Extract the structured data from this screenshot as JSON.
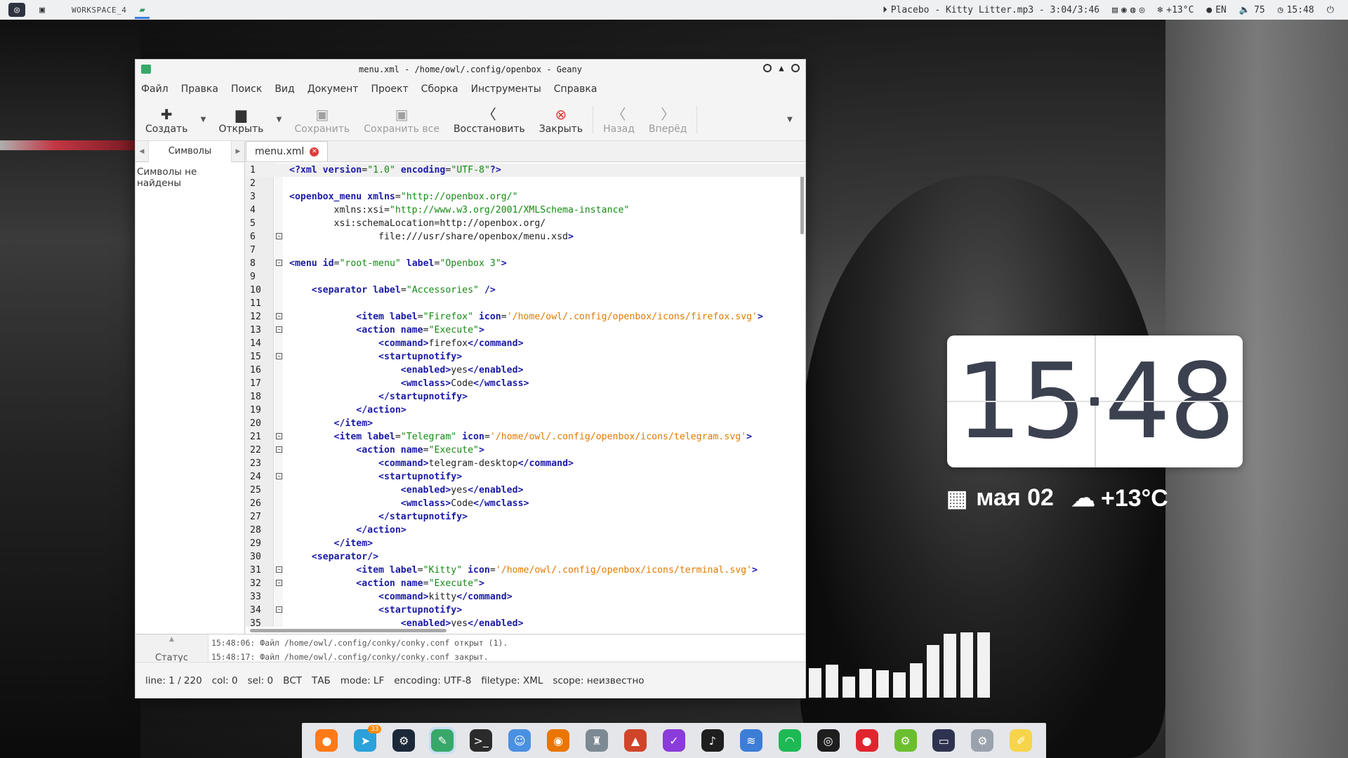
{
  "topbar": {
    "workspace": "WORKSPACE_4",
    "media": "Placebo - Kitty Litter.mp3 - 3:04/3:46",
    "temp": "+13°C",
    "lang": "EN",
    "volume": "75",
    "time": "15:48"
  },
  "window": {
    "title": "menu.xml - /home/owl/.config/openbox - Geany",
    "menu": [
      "Файл",
      "Правка",
      "Поиск",
      "Вид",
      "Документ",
      "Проект",
      "Сборка",
      "Инструменты",
      "Справка"
    ],
    "toolbar": {
      "create": "Создать",
      "open": "Открыть",
      "save": "Сохранить",
      "save_all": "Сохранить все",
      "revert": "Восстановить",
      "close": "Закрыть",
      "back": "Назад",
      "forward": "Вперёд"
    },
    "sidebar": {
      "tab": "Символы",
      "empty": "Символы не найдены"
    },
    "editor_tab": "menu.xml",
    "messages": {
      "label": "Статус",
      "lines": [
        "15:48:06: Файл /home/owl/.config/conky/conky.conf открыт (1).",
        "15:48:17: Файл /home/owl/.config/conky/conky.conf закрыт."
      ]
    },
    "status": {
      "line": "line: 1 / 220",
      "col": "col: 0",
      "sel": "sel: 0",
      "ins": "ВСТ",
      "tab": "ТАБ",
      "mode": "mode: LF",
      "encoding": "encoding: UTF-8",
      "filetype": "filetype: XML",
      "scope": "scope: неизвестно"
    }
  },
  "code_lines": [
    "<?xml version=\"1.0\" encoding=\"UTF-8\"?>",
    "",
    "<openbox_menu xmlns=\"http://openbox.org/\"",
    "        xmlns:xsi=\"http://www.w3.org/2001/XMLSchema-instance\"",
    "        xsi:schemaLocation=\"http://openbox.org/",
    "                file:///usr/share/openbox/menu.xsd\">",
    "",
    "<menu id=\"root-menu\" label=\"Openbox 3\">",
    "",
    "    <separator label=\"Accessories\" />",
    "",
    "            <item label=\"Firefox\" icon='/home/owl/.config/openbox/icons/firefox.svg'>",
    "            <action name=\"Execute\">",
    "                <command>firefox</command>",
    "                <startupnotify>",
    "                    <enabled>yes</enabled>",
    "                    <wmclass>Code</wmclass>",
    "                </startupnotify>",
    "            </action>",
    "        </item>",
    "        <item label=\"Telegram\" icon='/home/owl/.config/openbox/icons/telegram.svg'>",
    "            <action name=\"Execute\">",
    "                <command>telegram-desktop</command>",
    "                <startupnotify>",
    "                    <enabled>yes</enabled>",
    "                    <wmclass>Code</wmclass>",
    "                </startupnotify>",
    "            </action>",
    "        </item>",
    "    <separator/>",
    "            <item label=\"Kitty\" icon='/home/owl/.config/openbox/icons/terminal.svg'>",
    "            <action name=\"Execute\">",
    "                <command>kitty</command>",
    "                <startupnotify>",
    "                    <enabled>yes</enabled>"
  ],
  "fold_lines": [
    6,
    8,
    12,
    13,
    15,
    21,
    22,
    24,
    31,
    32,
    34
  ],
  "widgets": {
    "clock_hours": "15",
    "clock_minutes": "48",
    "date": "мая 02",
    "temp": "+13°C",
    "bar_levels": [
      0.45,
      0.5,
      0.32,
      0.44,
      0.42,
      0.38,
      0.52,
      0.8,
      0.97,
      0.99,
      0.99
    ]
  },
  "dock": {
    "items": [
      {
        "name": "firefox",
        "color": "#ff7a18",
        "glyph": "●"
      },
      {
        "name": "telegram",
        "color": "#2aa1da",
        "glyph": "➤",
        "badge": "33"
      },
      {
        "name": "steam",
        "color": "#1b2838",
        "glyph": "⚙"
      },
      {
        "name": "geany",
        "color": "#37a86a",
        "glyph": "✎",
        "active": true
      },
      {
        "name": "terminal",
        "color": "#2b2b2b",
        "glyph": ">_"
      },
      {
        "name": "finder",
        "color": "#4a90e2",
        "glyph": "☺"
      },
      {
        "name": "blender",
        "color": "#ea7600",
        "glyph": "◉"
      },
      {
        "name": "robot",
        "color": "#7d8a93",
        "glyph": "♜"
      },
      {
        "name": "rawtherapee",
        "color": "#d0452a",
        "glyph": "▲"
      },
      {
        "name": "editor",
        "color": "#8b3bd9",
        "glyph": "✓"
      },
      {
        "name": "music",
        "color": "#1e1e1e",
        "glyph": "♪"
      },
      {
        "name": "audio",
        "color": "#3d7dd6",
        "glyph": "≋"
      },
      {
        "name": "headphones",
        "color": "#1db954",
        "glyph": "◠"
      },
      {
        "name": "obs",
        "color": "#1e1e1e",
        "glyph": "◎"
      },
      {
        "name": "recorder",
        "color": "#e0252f",
        "glyph": "●"
      },
      {
        "name": "green-app",
        "color": "#6abf2e",
        "glyph": "⚙"
      },
      {
        "name": "screen",
        "color": "#2e3350",
        "glyph": "▭"
      },
      {
        "name": "settings",
        "color": "#9aa3ad",
        "glyph": "⚙"
      },
      {
        "name": "notes",
        "color": "#f6d54a",
        "glyph": "✐"
      }
    ]
  }
}
